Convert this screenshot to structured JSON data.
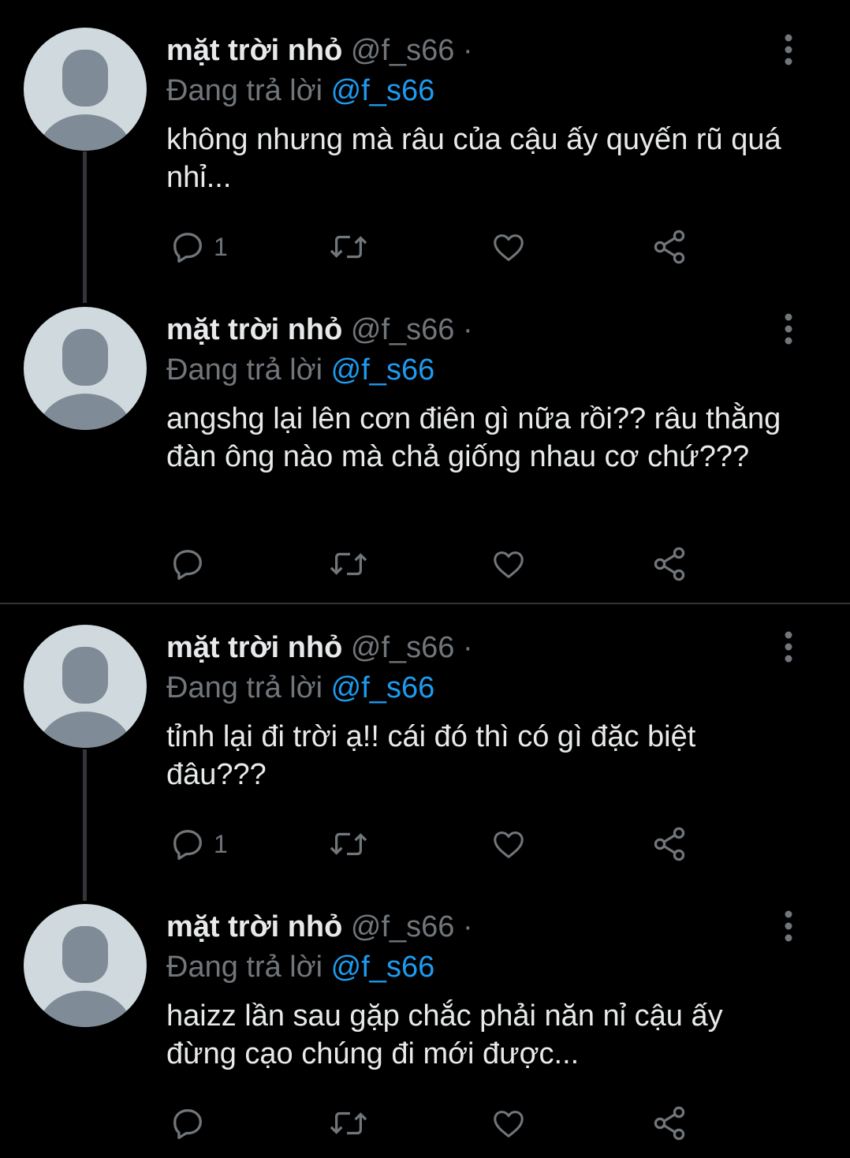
{
  "tweets": [
    {
      "name": "mặt trời nhỏ",
      "handle": "@f_s66",
      "dot": "·",
      "replying_label": "Đang trả lời",
      "replying_to": "@f_s66",
      "text": "không nhưng mà râu của cậu ấy quyến rũ quá nhỉ...",
      "reply_count": "1"
    },
    {
      "name": "mặt trời nhỏ",
      "handle": "@f_s66",
      "dot": "·",
      "replying_label": "Đang trả lời",
      "replying_to": "@f_s66",
      "text": "angshg lại lên cơn điên gì nữa rồi?? râu thằng đàn ông nào mà chả giống nhau cơ chứ???",
      "reply_count": ""
    },
    {
      "name": "mặt trời nhỏ",
      "handle": "@f_s66",
      "dot": "·",
      "replying_label": "Đang trả lời",
      "replying_to": "@f_s66",
      "text": "tỉnh lại đi trời ạ!! cái đó thì có gì đặc biệt đâu???",
      "reply_count": "1"
    },
    {
      "name": "mặt trời nhỏ",
      "handle": "@f_s66",
      "dot": "·",
      "replying_label": "Đang trả lời",
      "replying_to": "@f_s66",
      "text": "haizz lần sau gặp chắc phải năn nỉ cậu ấy đừng cạo chúng đi mới được...",
      "reply_count": ""
    }
  ],
  "icons": {
    "avatar": "default-avatar-icon",
    "more": "more-vertical-icon",
    "reply": "reply-bubble-icon",
    "retweet": "retweet-icon",
    "like": "heart-icon",
    "share": "share-icon"
  },
  "colors": {
    "background": "#000000",
    "text": "#e7e9ea",
    "muted": "#71767b",
    "mention": "#1d9bf0",
    "avatar_bg": "#cfd9de",
    "avatar_figure": "#7f8b96",
    "thread_line": "#333639"
  }
}
